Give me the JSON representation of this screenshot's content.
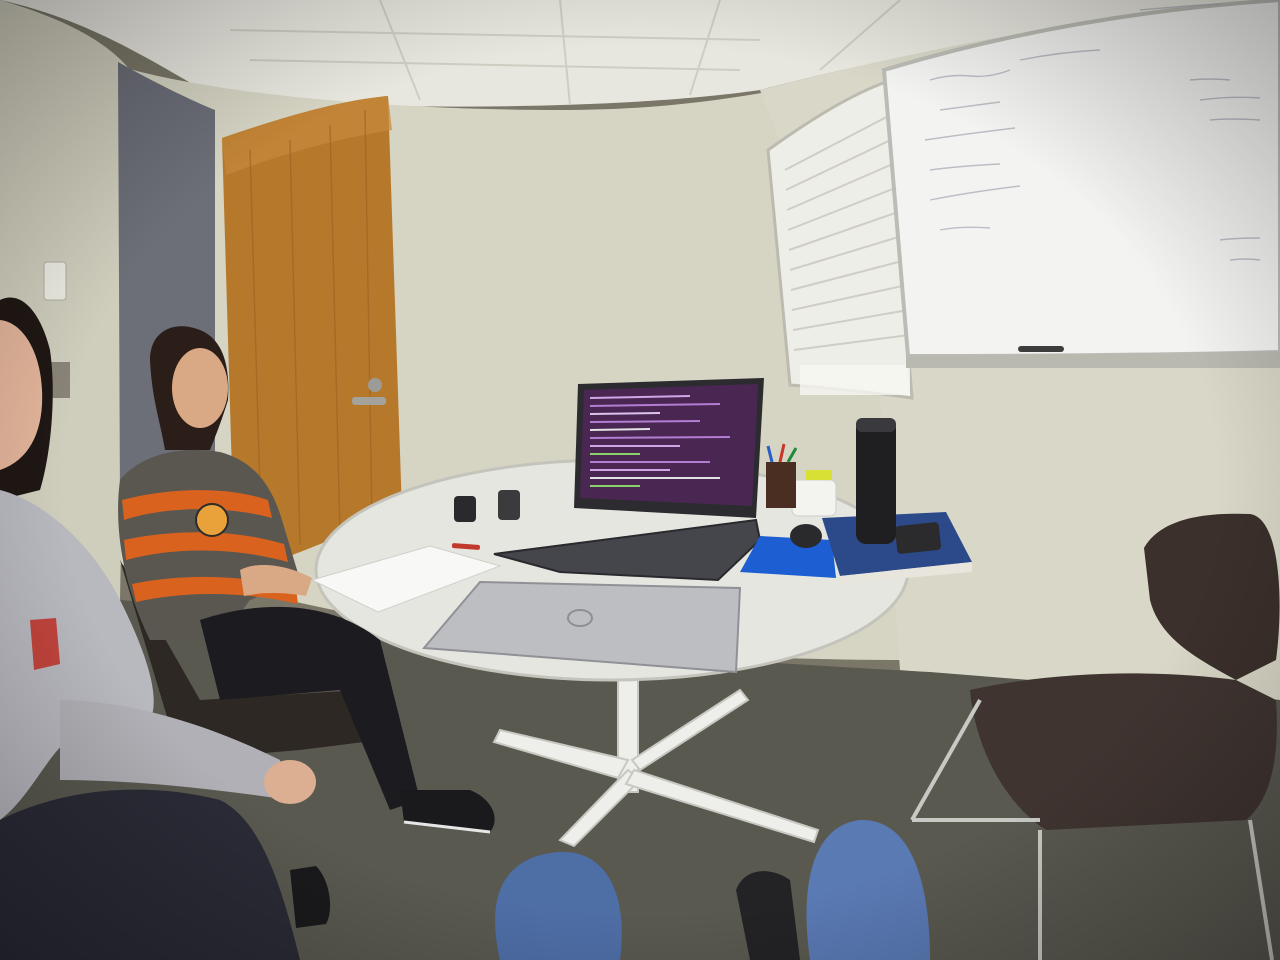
{
  "scene": {
    "description_free": true,
    "palette": {
      "ceiling": "#e9e8e0",
      "wall": "#d8d6c6",
      "wall_shadow": "#b9b6a4",
      "door": "#b8782a",
      "door_dark": "#8c5a1c",
      "carpet": "#5b5a52",
      "table": "#e6e6e2",
      "laptop_body": "#3a3b40",
      "laptop_screen": "#4b2a55",
      "whiteboard": "#f4f4f2",
      "chair": "#3a302c",
      "orange_stripe": "#d9631e",
      "grey_stripe": "#5a5650",
      "jeans": "#4f6fa6",
      "mousepad": "#1f5fd0",
      "book": "#2c4a8a"
    }
  }
}
